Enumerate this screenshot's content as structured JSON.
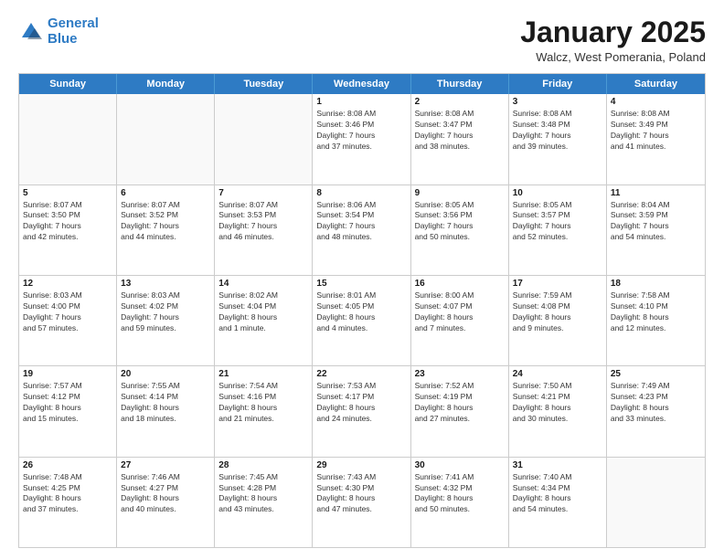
{
  "header": {
    "logo_line1": "General",
    "logo_line2": "Blue",
    "month_year": "January 2025",
    "location": "Walcz, West Pomerania, Poland"
  },
  "day_headers": [
    "Sunday",
    "Monday",
    "Tuesday",
    "Wednesday",
    "Thursday",
    "Friday",
    "Saturday"
  ],
  "weeks": [
    [
      {
        "day": "",
        "info": ""
      },
      {
        "day": "",
        "info": ""
      },
      {
        "day": "",
        "info": ""
      },
      {
        "day": "1",
        "info": "Sunrise: 8:08 AM\nSunset: 3:46 PM\nDaylight: 7 hours\nand 37 minutes."
      },
      {
        "day": "2",
        "info": "Sunrise: 8:08 AM\nSunset: 3:47 PM\nDaylight: 7 hours\nand 38 minutes."
      },
      {
        "day": "3",
        "info": "Sunrise: 8:08 AM\nSunset: 3:48 PM\nDaylight: 7 hours\nand 39 minutes."
      },
      {
        "day": "4",
        "info": "Sunrise: 8:08 AM\nSunset: 3:49 PM\nDaylight: 7 hours\nand 41 minutes."
      }
    ],
    [
      {
        "day": "5",
        "info": "Sunrise: 8:07 AM\nSunset: 3:50 PM\nDaylight: 7 hours\nand 42 minutes."
      },
      {
        "day": "6",
        "info": "Sunrise: 8:07 AM\nSunset: 3:52 PM\nDaylight: 7 hours\nand 44 minutes."
      },
      {
        "day": "7",
        "info": "Sunrise: 8:07 AM\nSunset: 3:53 PM\nDaylight: 7 hours\nand 46 minutes."
      },
      {
        "day": "8",
        "info": "Sunrise: 8:06 AM\nSunset: 3:54 PM\nDaylight: 7 hours\nand 48 minutes."
      },
      {
        "day": "9",
        "info": "Sunrise: 8:05 AM\nSunset: 3:56 PM\nDaylight: 7 hours\nand 50 minutes."
      },
      {
        "day": "10",
        "info": "Sunrise: 8:05 AM\nSunset: 3:57 PM\nDaylight: 7 hours\nand 52 minutes."
      },
      {
        "day": "11",
        "info": "Sunrise: 8:04 AM\nSunset: 3:59 PM\nDaylight: 7 hours\nand 54 minutes."
      }
    ],
    [
      {
        "day": "12",
        "info": "Sunrise: 8:03 AM\nSunset: 4:00 PM\nDaylight: 7 hours\nand 57 minutes."
      },
      {
        "day": "13",
        "info": "Sunrise: 8:03 AM\nSunset: 4:02 PM\nDaylight: 7 hours\nand 59 minutes."
      },
      {
        "day": "14",
        "info": "Sunrise: 8:02 AM\nSunset: 4:04 PM\nDaylight: 8 hours\nand 1 minute."
      },
      {
        "day": "15",
        "info": "Sunrise: 8:01 AM\nSunset: 4:05 PM\nDaylight: 8 hours\nand 4 minutes."
      },
      {
        "day": "16",
        "info": "Sunrise: 8:00 AM\nSunset: 4:07 PM\nDaylight: 8 hours\nand 7 minutes."
      },
      {
        "day": "17",
        "info": "Sunrise: 7:59 AM\nSunset: 4:08 PM\nDaylight: 8 hours\nand 9 minutes."
      },
      {
        "day": "18",
        "info": "Sunrise: 7:58 AM\nSunset: 4:10 PM\nDaylight: 8 hours\nand 12 minutes."
      }
    ],
    [
      {
        "day": "19",
        "info": "Sunrise: 7:57 AM\nSunset: 4:12 PM\nDaylight: 8 hours\nand 15 minutes."
      },
      {
        "day": "20",
        "info": "Sunrise: 7:55 AM\nSunset: 4:14 PM\nDaylight: 8 hours\nand 18 minutes."
      },
      {
        "day": "21",
        "info": "Sunrise: 7:54 AM\nSunset: 4:16 PM\nDaylight: 8 hours\nand 21 minutes."
      },
      {
        "day": "22",
        "info": "Sunrise: 7:53 AM\nSunset: 4:17 PM\nDaylight: 8 hours\nand 24 minutes."
      },
      {
        "day": "23",
        "info": "Sunrise: 7:52 AM\nSunset: 4:19 PM\nDaylight: 8 hours\nand 27 minutes."
      },
      {
        "day": "24",
        "info": "Sunrise: 7:50 AM\nSunset: 4:21 PM\nDaylight: 8 hours\nand 30 minutes."
      },
      {
        "day": "25",
        "info": "Sunrise: 7:49 AM\nSunset: 4:23 PM\nDaylight: 8 hours\nand 33 minutes."
      }
    ],
    [
      {
        "day": "26",
        "info": "Sunrise: 7:48 AM\nSunset: 4:25 PM\nDaylight: 8 hours\nand 37 minutes."
      },
      {
        "day": "27",
        "info": "Sunrise: 7:46 AM\nSunset: 4:27 PM\nDaylight: 8 hours\nand 40 minutes."
      },
      {
        "day": "28",
        "info": "Sunrise: 7:45 AM\nSunset: 4:28 PM\nDaylight: 8 hours\nand 43 minutes."
      },
      {
        "day": "29",
        "info": "Sunrise: 7:43 AM\nSunset: 4:30 PM\nDaylight: 8 hours\nand 47 minutes."
      },
      {
        "day": "30",
        "info": "Sunrise: 7:41 AM\nSunset: 4:32 PM\nDaylight: 8 hours\nand 50 minutes."
      },
      {
        "day": "31",
        "info": "Sunrise: 7:40 AM\nSunset: 4:34 PM\nDaylight: 8 hours\nand 54 minutes."
      },
      {
        "day": "",
        "info": ""
      }
    ]
  ]
}
